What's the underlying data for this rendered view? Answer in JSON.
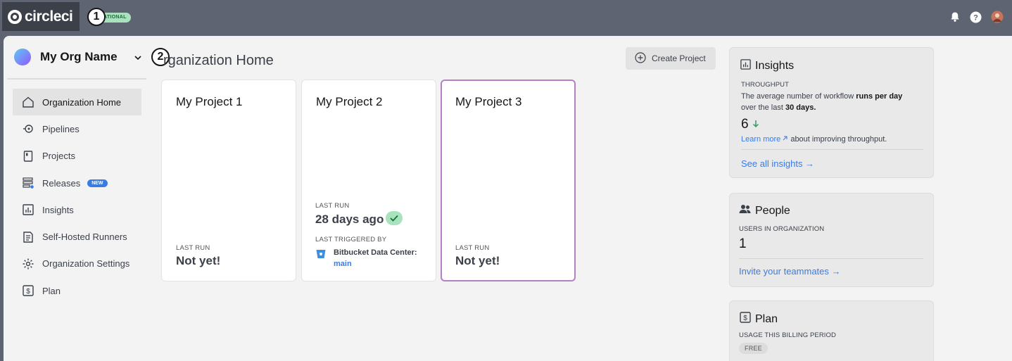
{
  "brand": {
    "name": "circleci"
  },
  "status": {
    "label": "ATIONAL"
  },
  "steps": {
    "one": "1",
    "two": "2"
  },
  "org": {
    "name": "My Org Name"
  },
  "nav": [
    {
      "label": "Organization Home"
    },
    {
      "label": "Pipelines"
    },
    {
      "label": "Projects"
    },
    {
      "label": "Releases",
      "badge": "NEW"
    },
    {
      "label": "Insights"
    },
    {
      "label": "Self-Hosted Runners"
    },
    {
      "label": "Organization Settings"
    },
    {
      "label": "Plan"
    }
  ],
  "page": {
    "title": "rganization Home",
    "create_label": "Create Project"
  },
  "projects": [
    {
      "name": "My Project 1",
      "last_run_label": "LAST RUN",
      "last_run": "Not yet!"
    },
    {
      "name": "My Project 2",
      "last_run_label": "LAST RUN",
      "last_run": "28 days ago",
      "triggered_label": "LAST TRIGGERED BY",
      "trigger_source": "Bitbucket Data Center:",
      "branch": "main"
    },
    {
      "name": "My Project 3",
      "last_run_label": "LAST RUN",
      "last_run": "Not yet!"
    }
  ],
  "insights": {
    "title": "Insights",
    "label": "THROUGHPUT",
    "desc_1": "The average number of workflow ",
    "desc_bold_1": "runs per day",
    "desc_2": "over the last ",
    "desc_bold_2": "30 days.",
    "value": "6",
    "learn_more": "Learn more",
    "learn_more_suffix": " about improving throughput.",
    "see_all": "See all insights →"
  },
  "people": {
    "title": "People",
    "label": "USERS IN ORGANIZATION",
    "value": "1",
    "invite": "Invite your teammates →"
  },
  "plan": {
    "title": "Plan",
    "label": "USAGE THIS BILLING PERIOD",
    "tier": "FREE"
  },
  "colors": {
    "accent_link": "#3b7be0",
    "status_green": "#a9e3bd",
    "selected_border": "#b380c4"
  }
}
